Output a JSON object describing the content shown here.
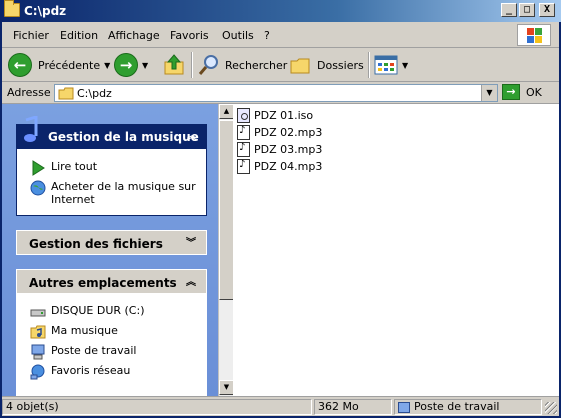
{
  "window": {
    "title": "C:\\pdz",
    "controls": {
      "minimize": "_",
      "maximize": "□",
      "close": "X"
    }
  },
  "menubar": {
    "items": [
      "Fichier",
      "Edition",
      "Affichage",
      "Favoris",
      "Outils",
      "?"
    ]
  },
  "toolbar": {
    "back_label": "Précédente",
    "search_label": "Rechercher",
    "folders_label": "Dossiers"
  },
  "address": {
    "label": "Adresse",
    "value": "C:\\pdz",
    "go_label": "OK"
  },
  "tasks": {
    "music": {
      "title": "Gestion de la musique",
      "items": [
        "Lire tout",
        "Acheter de la musique sur Internet"
      ]
    },
    "files": {
      "title": "Gestion des fichiers"
    },
    "other": {
      "title": "Autres emplacements",
      "items": [
        "DISQUE DUR (C:)",
        "Ma musique",
        "Poste de travail",
        "Favoris réseau"
      ]
    }
  },
  "files": [
    {
      "name": "PDZ 01.iso",
      "icon": "iso-file-icon"
    },
    {
      "name": "PDZ 02.mp3",
      "icon": "mp3-file-icon"
    },
    {
      "name": "PDZ 03.mp3",
      "icon": "mp3-file-icon"
    },
    {
      "name": "PDZ 04.mp3",
      "icon": "mp3-file-icon"
    }
  ],
  "status": {
    "objects": "4 objet(s)",
    "size": "362 Mo",
    "location": "Poste de travail"
  },
  "colors": {
    "title_bar": "#0a246a",
    "task_pane": "#7ba0e0",
    "chrome": "#d4d0c8"
  }
}
